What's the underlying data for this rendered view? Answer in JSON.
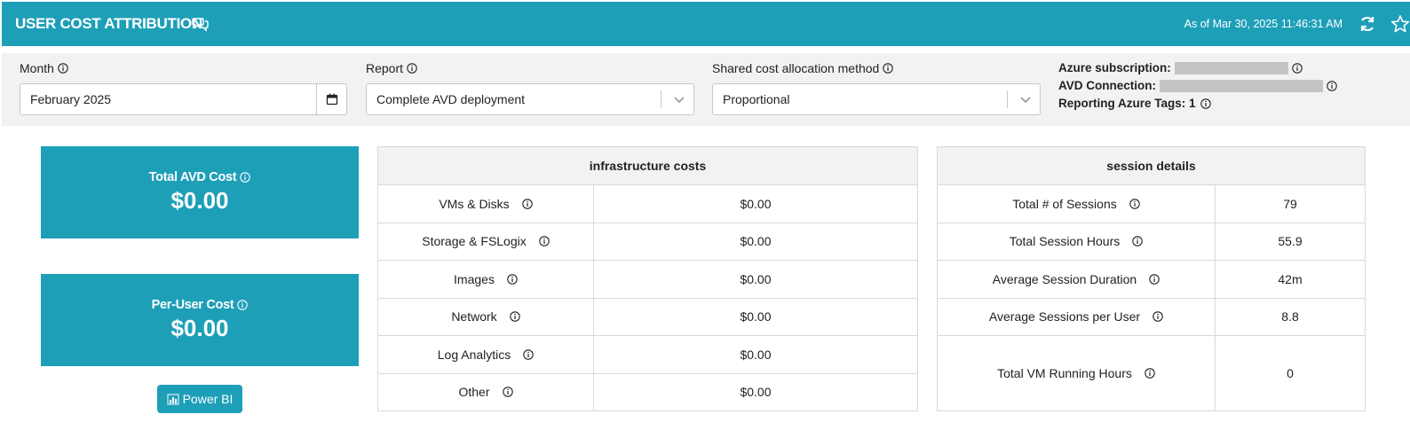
{
  "header": {
    "title": "USER COST ATTRIBUTION",
    "as_of": "As of Mar 30, 2025 11:46:31 AM",
    "bg_color": "#1e9fb8"
  },
  "filters": {
    "month": {
      "label": "Month",
      "value": "February 2025"
    },
    "report": {
      "label": "Report",
      "value": "Complete AVD deployment"
    },
    "allocation": {
      "label": "Shared cost allocation method",
      "value": "Proportional"
    },
    "azure_subscription_label": "Azure subscription:",
    "avd_connection_label": "AVD Connection:",
    "reporting_tags": "Reporting Azure Tags: 1"
  },
  "cards": {
    "total": {
      "label": "Total AVD Cost",
      "value": "$0.00"
    },
    "per_user": {
      "label": "Per-User Cost",
      "value": "$0.00"
    },
    "power_bi": "Power BI"
  },
  "infra": {
    "title": "infrastructure costs",
    "rows": [
      {
        "label": "VMs & Disks",
        "value": "$0.00"
      },
      {
        "label": "Storage & FSLogix",
        "value": "$0.00"
      },
      {
        "label": "Images",
        "value": "$0.00"
      },
      {
        "label": "Network",
        "value": "$0.00"
      },
      {
        "label": "Log Analytics",
        "value": "$0.00"
      },
      {
        "label": "Other",
        "value": "$0.00"
      }
    ]
  },
  "session": {
    "title": "session details",
    "rows": [
      {
        "label": "Total # of Sessions",
        "value": "79"
      },
      {
        "label": "Total Session Hours",
        "value": "55.9"
      },
      {
        "label": "Average Session Duration",
        "value": "42m"
      },
      {
        "label": "Average Sessions per User",
        "value": "8.8"
      },
      {
        "label": "Total VM Running Hours",
        "value": "0"
      }
    ]
  }
}
